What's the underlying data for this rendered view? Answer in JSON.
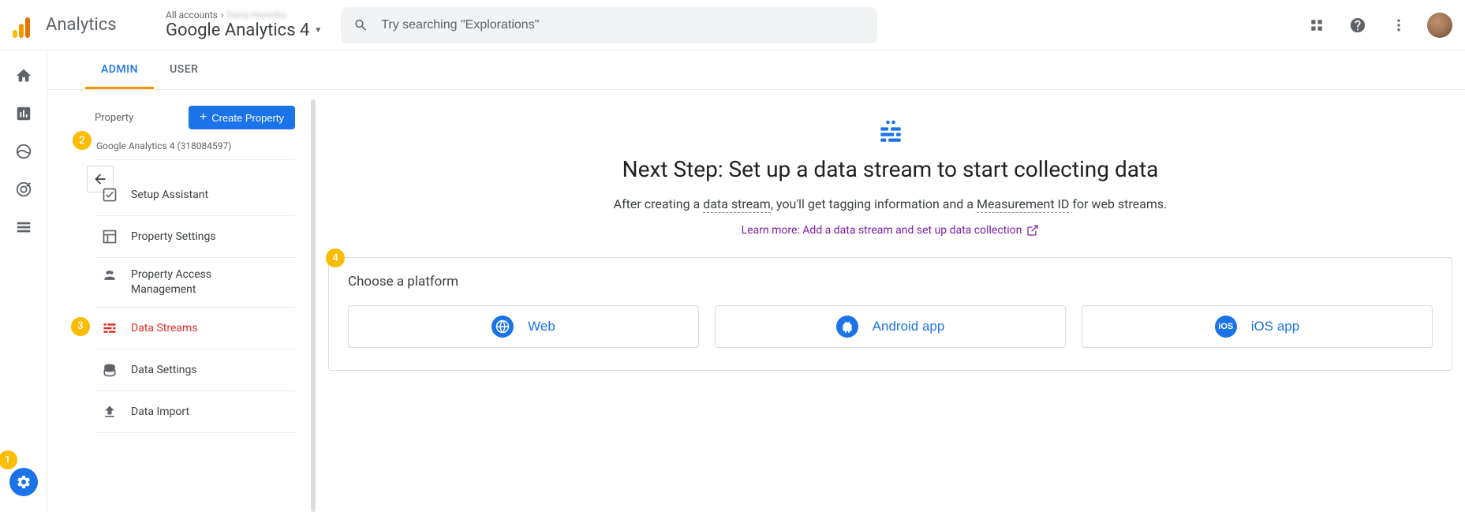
{
  "brand": "Analytics",
  "breadcrumb": {
    "all": "All accounts",
    "name": "Daria Herenko"
  },
  "property_selector": "Google Analytics 4",
  "search": {
    "placeholder": "Try searching \"Explorations\""
  },
  "tabs": {
    "admin": "ADMIN",
    "user": "USER"
  },
  "sidebar": {
    "property_label": "Property",
    "create_btn": "Create Property",
    "property_name": "Google Analytics 4 (318084597)",
    "items": [
      {
        "label": "Setup Assistant"
      },
      {
        "label": "Property Settings"
      },
      {
        "label": "Property Access\nManagement"
      },
      {
        "label": "Data Streams"
      },
      {
        "label": "Data Settings"
      },
      {
        "label": "Data Import"
      }
    ]
  },
  "main": {
    "title": "Next Step: Set up a data stream to start collecting data",
    "sub_pre": "After creating a ",
    "sub_term1": "data stream",
    "sub_mid": ", you'll get tagging information and a ",
    "sub_term2": "Measurement ID",
    "sub_post": " for web streams.",
    "learn": "Learn more: Add a data stream and set up data collection",
    "choose": "Choose a platform",
    "platforms": {
      "web": "Web",
      "android": "Android app",
      "ios": "iOS app"
    }
  },
  "badges": {
    "b1": "1",
    "b2": "2",
    "b3": "3",
    "b4": "4"
  }
}
